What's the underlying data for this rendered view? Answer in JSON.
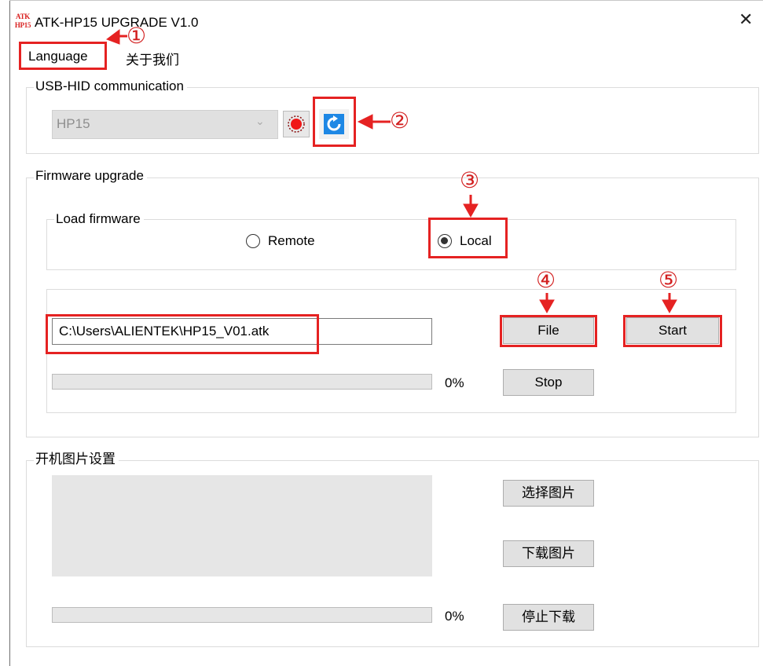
{
  "window": {
    "title": "ATK-HP15 UPGRADE V1.0",
    "logo_text_top": "ATK",
    "logo_text_bottom": "HP15",
    "close_glyph": "✕"
  },
  "menu": {
    "items": [
      {
        "label": "Language"
      },
      {
        "label": "关于我们"
      }
    ]
  },
  "usb": {
    "group_label": "USB-HID communication",
    "device_value": "HP15",
    "status_icon": "record-icon",
    "refresh_icon": "refresh-icon"
  },
  "firmware": {
    "group_label": "Firmware upgrade",
    "load_label": "Load firmware",
    "radio_remote": "Remote",
    "radio_local": "Local",
    "selected_source": "Local",
    "file_path": "C:\\Users\\ALIENTEK\\HP15_V01.atk",
    "file_button": "File",
    "start_button": "Start",
    "stop_button": "Stop",
    "progress_text": "0%",
    "progress": 0
  },
  "boot_image": {
    "group_label": "开机图片设置",
    "select_button": "选择图片",
    "download_button": "下载图片",
    "stop_button": "停止下载",
    "progress_text": "0%",
    "progress": 0
  },
  "annotations": {
    "markers": [
      "①",
      "②",
      "③",
      "④",
      "⑤"
    ],
    "color": "#e52222"
  }
}
